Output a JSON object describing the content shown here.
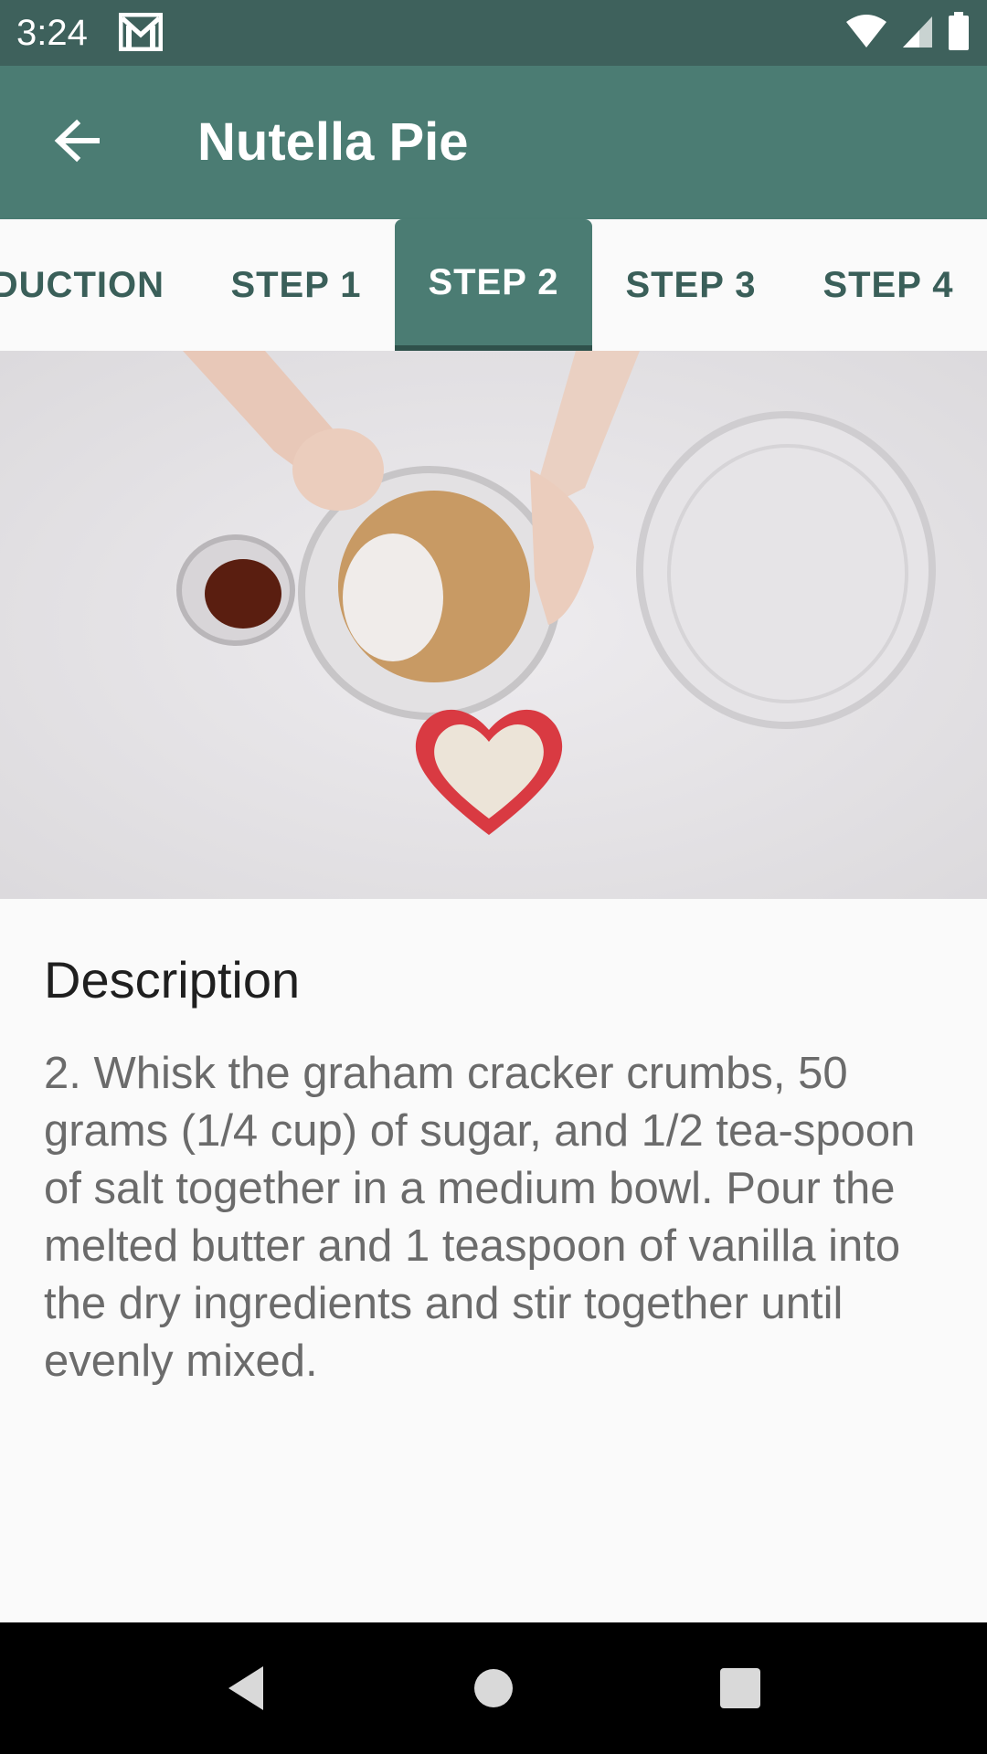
{
  "status_bar": {
    "time": "3:24",
    "icons": [
      "gmail-icon",
      "wifi-icon",
      "signal-icon",
      "battery-icon"
    ]
  },
  "app_bar": {
    "title": "Nutella Pie",
    "back_icon": "arrow-left-icon"
  },
  "tabs": {
    "items": [
      {
        "label": "DUCTION"
      },
      {
        "label": "STEP 1"
      },
      {
        "label": "STEP 2"
      },
      {
        "label": "STEP 3"
      },
      {
        "label": "STEP 4"
      }
    ],
    "selected_label": "STEP 2"
  },
  "media": {
    "description": "video frame"
  },
  "description": {
    "heading": "Description",
    "text": "2. Whisk the graham cracker crumbs, 50 grams (1/4 cup) of sugar, and 1/2 tea-spoon of salt together in a medium bowl. Pour the melted butter and 1 teaspoon of vanilla into the dry ingredients and stir together until evenly mixed."
  },
  "nav_bar": {
    "icons": [
      "back-triangle-icon",
      "home-circle-icon",
      "recents-square-icon"
    ]
  },
  "colors": {
    "status_bar": "#3e615c",
    "app_bar": "#4b7c73",
    "tab_text": "#3a5f59"
  }
}
